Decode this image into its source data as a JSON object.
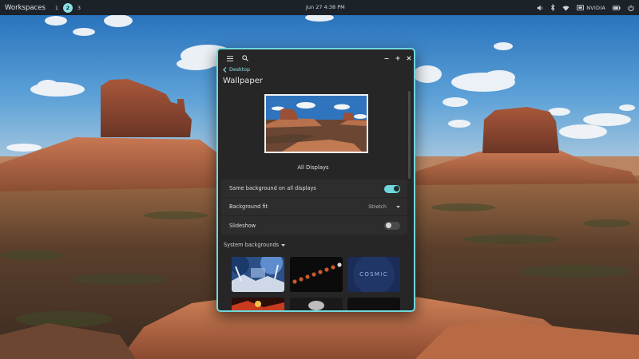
{
  "top_panel": {
    "workspaces_label": "Workspaces",
    "workspaces": [
      "1",
      "2",
      "3"
    ],
    "active_workspace": "2",
    "clock": "Jun 27 4:38 PM",
    "tray": {
      "nvidia_label": "NVIDIA"
    }
  },
  "window": {
    "breadcrumb": "Desktop",
    "title": "Wallpaper",
    "display_caption": "All Displays",
    "settings": {
      "same_background_label": "Same background on all displays",
      "same_background_on": true,
      "background_fit_label": "Background fit",
      "background_fit_value": "Stretch",
      "slideshow_label": "Slideshow",
      "slideshow_on": false
    },
    "system_backgrounds_label": "System backgrounds",
    "thumb_cosmic_label": "COSMIC"
  },
  "colors": {
    "accent": "#6fd7dc",
    "panel_bg": "#1b1f22",
    "window_bg": "#262626"
  },
  "icons": [
    "hamburger-icon",
    "search-icon",
    "minimize-icon",
    "maximize-icon",
    "close-icon",
    "chevron-left-icon",
    "chevron-down-icon",
    "volume-icon",
    "bluetooth-icon",
    "wifi-icon",
    "gpu-icon",
    "battery-icon",
    "power-icon"
  ]
}
